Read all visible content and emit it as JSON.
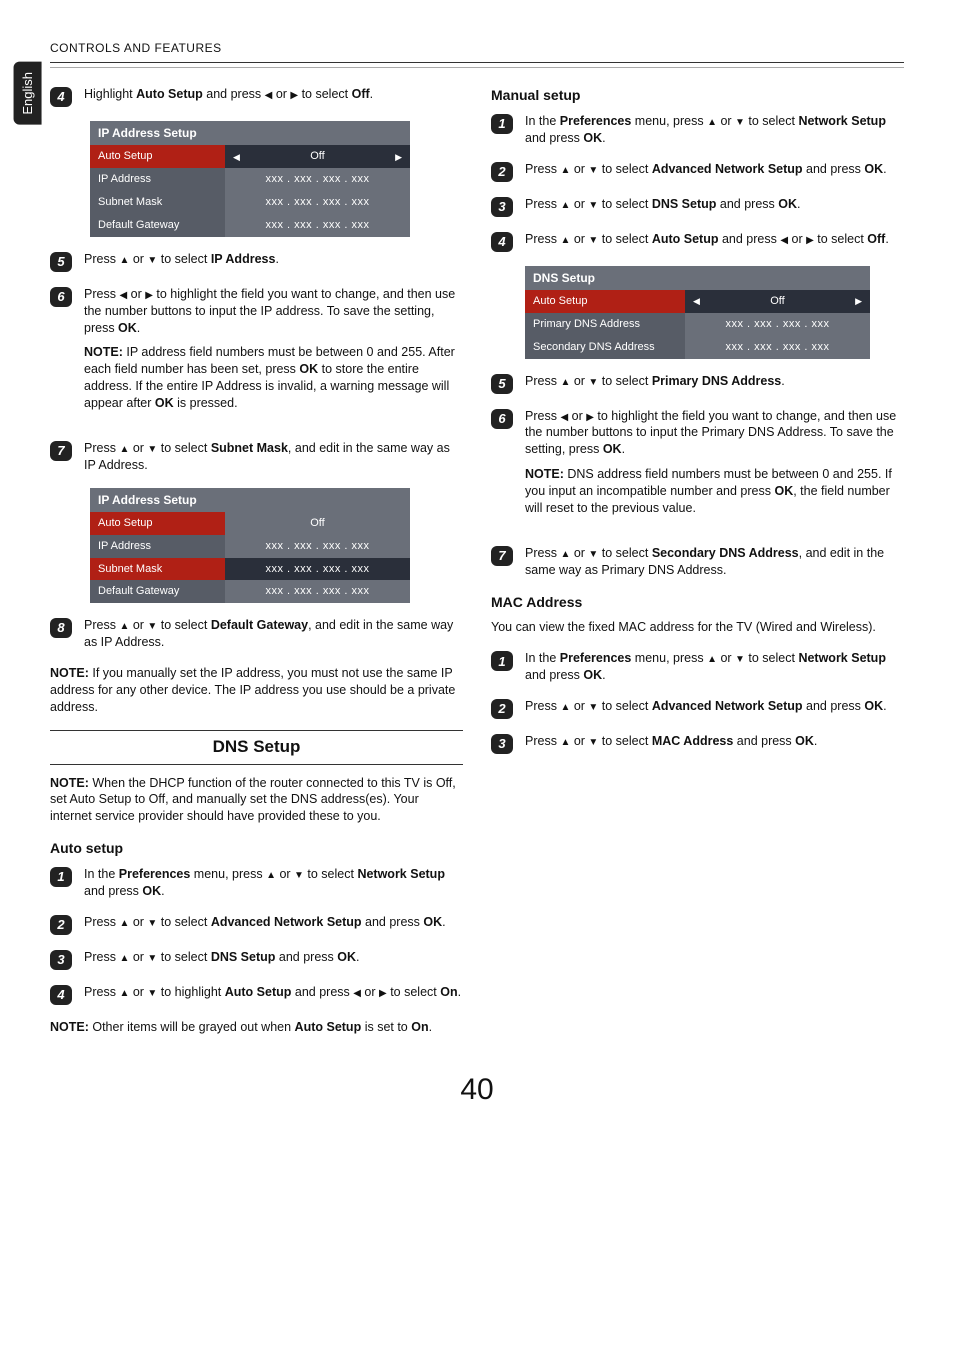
{
  "header": {
    "breadcrumb": "CONTROLS AND FEATURES",
    "lang": "English"
  },
  "icons": {
    "up": "▲",
    "down": "▼",
    "left": "◀",
    "right": "▶"
  },
  "left": {
    "step4": {
      "t1": "Highlight ",
      "b1": "Auto Setup",
      "t2": " and press ",
      "t3": " or ",
      "t4": " to select ",
      "b2": "Off",
      "t5": "."
    },
    "menu1": {
      "title": "IP Address Setup",
      "r1l": "Auto Setup",
      "r1v": "Off",
      "r2l": "IP Address",
      "r2v": "xxx . xxx . xxx . xxx",
      "r3l": "Subnet Mask",
      "r3v": "xxx . xxx . xxx . xxx",
      "r4l": "Default Gateway",
      "r4v": "xxx . xxx . xxx . xxx"
    },
    "step5": {
      "t1": "Press ",
      "t2": " or ",
      "t3": " to select ",
      "b1": "IP Address",
      "t4": "."
    },
    "step6": {
      "t1": "Press ",
      "t2": " or ",
      "t3": " to highlight the field you want to change, and then use the number buttons to input the IP address. To save the setting, press ",
      "b1": "OK",
      "t4": "."
    },
    "note6": {
      "nb": "NOTE:",
      "t1": " IP address field numbers must be between 0 and 255. After each field number has been set, press ",
      "b1": "OK",
      "t2": " to store the entire address. If the entire IP Address is invalid, a warning message will appear after ",
      "b2": "OK",
      "t3": " is pressed."
    },
    "step7": {
      "t1": "Press ",
      "t2": " or ",
      "t3": " to select ",
      "b1": "Subnet Mask",
      "t4": ", and edit in the same way as IP Address."
    },
    "menu2": {
      "title": "IP Address Setup",
      "r1l": "Auto Setup",
      "r1v": "Off",
      "r2l": "IP Address",
      "r2v": "xxx . xxx . xxx . xxx",
      "r3l": "Subnet Mask",
      "r3v": "xxx . xxx . xxx . xxx",
      "r4l": "Default Gateway",
      "r4v": "xxx . xxx . xxx . xxx"
    },
    "step8": {
      "t1": "Press ",
      "t2": " or ",
      "t3": " to select ",
      "b1": "Default Gateway",
      "t4": ", and edit in the same way as IP Address."
    },
    "noteManual": {
      "nb": "NOTE:",
      "t1": " If you manually set the IP address, you must not use the same IP address for any other device. The IP address you use should be a private address."
    },
    "sectionTitle": "DNS Setup",
    "noteDNS": {
      "nb": "NOTE:",
      "t1": " When the DHCP function of the router connected to this TV is Off, set Auto Setup to Off, and manually set the DNS address(es). Your internet service provider should have provided these to you."
    },
    "autoSetupTitle": "Auto setup",
    "as1": {
      "t1": "In the ",
      "b1": "Preferences",
      "t2": " menu, press ",
      "t3": " or ",
      "t4": " to select ",
      "b2": "Network Setup",
      "t5": " and press ",
      "b3": "OK",
      "t6": "."
    },
    "as2": {
      "t1": "Press ",
      "t2": " or ",
      "t3": " to select ",
      "b1": "Advanced Network Setup",
      "t4": " and press ",
      "b2": "OK",
      "t5": "."
    },
    "as3": {
      "t1": "Press ",
      "t2": " or ",
      "t3": " to select ",
      "b1": "DNS Setup",
      "t4": " and press ",
      "b2": "OK",
      "t5": "."
    },
    "as4": {
      "t1": "Press ",
      "t2": " or ",
      "t3": " to highlight ",
      "b1": "Auto Setup",
      "t4": " and press ",
      "t5": " or ",
      "t6": " to select ",
      "b2": "On",
      "t7": "."
    },
    "noteOn": {
      "nb": "NOTE:",
      "t1": " Other items will be grayed out when ",
      "b1": "Auto Setup",
      "t2": " is set to ",
      "b2": "On",
      "t3": "."
    }
  },
  "right": {
    "manualTitle": "Manual setup",
    "ms1": {
      "t1": "In the ",
      "b1": "Preferences",
      "t2": " menu, press ",
      "t3": " or ",
      "t4": " to select ",
      "b2": "Network Setup",
      "t5": " and press ",
      "b3": "OK",
      "t6": "."
    },
    "ms2": {
      "t1": "Press ",
      "t2": " or ",
      "t3": " to select ",
      "b1": "Advanced Network Setup",
      "t4": " and press ",
      "b2": "OK",
      "t5": "."
    },
    "ms3": {
      "t1": "Press ",
      "t2": " or ",
      "t3": " to select ",
      "b1": "DNS Setup",
      "t4": " and press ",
      "b2": "OK",
      "t5": "."
    },
    "ms4": {
      "t1": "Press ",
      "t2": " or ",
      "t3": " to select ",
      "b1": "Auto Setup",
      "t4": " and press ",
      "t5": " or ",
      "t6": " to select ",
      "b2": "Off",
      "t7": "."
    },
    "menu3": {
      "title": "DNS Setup",
      "r1l": "Auto Setup",
      "r1v": "Off",
      "r2l": "Primary DNS Address",
      "r2v": "xxx . xxx . xxx . xxx",
      "r3l": "Secondary DNS Address",
      "r3v": "xxx . xxx . xxx . xxx"
    },
    "ms5": {
      "t1": "Press ",
      "t2": " or ",
      "t3": " to select ",
      "b1": "Primary DNS Address",
      "t4": "."
    },
    "ms6": {
      "t1": "Press ",
      "t2": " or ",
      "t3": " to highlight the field you want to change, and then use the number buttons to input the Primary DNS Address. To save the setting, press ",
      "b1": "OK",
      "t4": "."
    },
    "note6r": {
      "nb": "NOTE:",
      "t1": " DNS address field numbers must be between 0 and 255. If you input an incompatible number and press ",
      "b1": "OK",
      "t2": ", the field number will reset to the previous value."
    },
    "ms7": {
      "t1": "Press ",
      "t2": " or ",
      "t3": " to select ",
      "b1": "Secondary DNS Address",
      "t4": ", and edit in the same way as Primary DNS Address."
    },
    "macTitle": "MAC Address",
    "macIntro": " You can view the fixed MAC address for the TV (Wired and Wireless).",
    "mac1": {
      "t1": "In the ",
      "b1": "Preferences",
      "t2": " menu, press ",
      "t3": " or ",
      "t4": " to select ",
      "b2": "Network Setup",
      "t5": " and press ",
      "b3": "OK",
      "t6": "."
    },
    "mac2": {
      "t1": "Press ",
      "t2": " or ",
      "t3": " to select ",
      "b1": "Advanced Network Setup",
      "t4": " and press ",
      "b2": "OK",
      "t5": "."
    },
    "mac3": {
      "t1": "Press ",
      "t2": " or ",
      "t3": " to select ",
      "b1": "MAC Address",
      "t4": " and press ",
      "b2": "OK",
      "t5": "."
    }
  },
  "pageNum": "40"
}
